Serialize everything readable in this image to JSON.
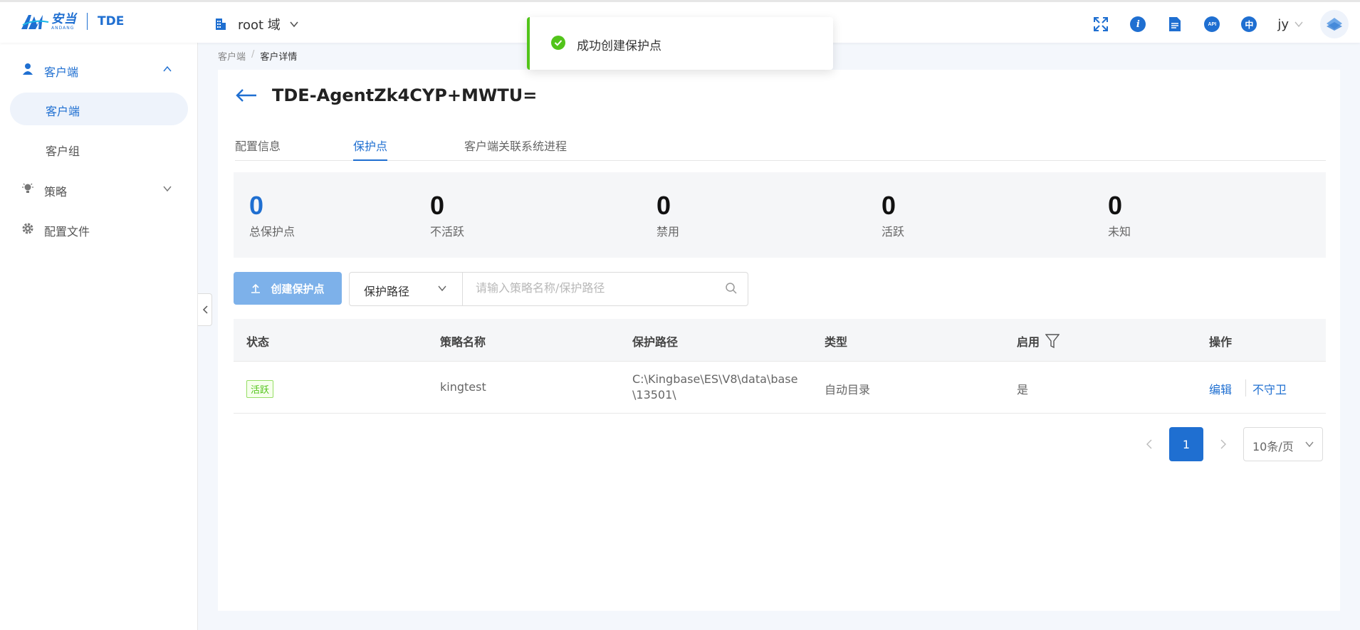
{
  "header": {
    "brand_cn": "安当",
    "brand_en": "ANDANG",
    "product": "TDE",
    "domain": "root 域",
    "icons": [
      "fullscreen-icon",
      "info-icon",
      "document-icon",
      "api-icon",
      "language-icon"
    ],
    "api_label": "API",
    "lang_label": "中",
    "user": "jy"
  },
  "sidebar": {
    "groups": [
      {
        "label": "客户端",
        "icon": "user-icon",
        "expanded": true
      },
      {
        "label": "策略",
        "icon": "bulb-icon",
        "expanded": false
      },
      {
        "label": "配置文件",
        "icon": "gear-icon"
      }
    ],
    "subitems": [
      {
        "label": "客户端",
        "active": true
      },
      {
        "label": "客户组",
        "active": false
      }
    ]
  },
  "breadcrumb": {
    "items": [
      "客户端",
      "客户详情"
    ],
    "separator": "/"
  },
  "page": {
    "title": "TDE-AgentZk4CYP+MWTU="
  },
  "tabs": [
    {
      "label": "配置信息",
      "active": false
    },
    {
      "label": "保护点",
      "active": true
    },
    {
      "label": "客户端关联系统进程",
      "active": false
    }
  ],
  "stats": [
    {
      "value": "0",
      "label": "总保护点"
    },
    {
      "value": "0",
      "label": "不活跃"
    },
    {
      "value": "0",
      "label": "禁用"
    },
    {
      "value": "0",
      "label": "活跃"
    },
    {
      "value": "0",
      "label": "未知"
    }
  ],
  "toolbar": {
    "create_label": "创建保护点",
    "filter_selected": "保护路径",
    "search_placeholder": "请输入策略名称/保护路径"
  },
  "table": {
    "columns": [
      "状态",
      "策略名称",
      "保护路径",
      "类型",
      "启用",
      "操作"
    ],
    "rows": [
      {
        "status": "活跃",
        "policy": "kingtest",
        "path_line1": "C:\\Kingbase\\ES\\V8\\data\\base",
        "path_line2": "\\13501\\",
        "type": "自动目录",
        "enabled": "是",
        "action_edit": "编辑",
        "action_unguard": "不守卫"
      }
    ]
  },
  "pagination": {
    "current": "1",
    "page_size": "10条/页"
  },
  "toast": {
    "message": "成功创建保护点"
  },
  "colors": {
    "primary": "#1f6fd1",
    "success": "#52c41a",
    "create_button": "#7db1ea"
  }
}
